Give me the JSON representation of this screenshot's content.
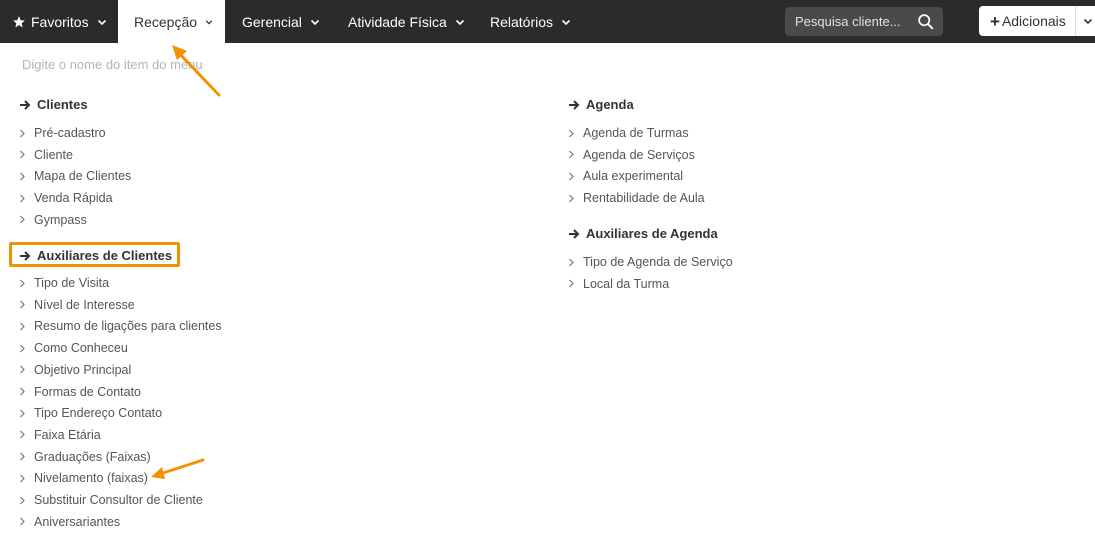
{
  "nav": {
    "favoritos": "Favoritos",
    "recepcao": "Recepção",
    "gerencial": "Gerencial",
    "atividade_fisica": "Atividade Física",
    "relatorios": "Relatórios",
    "search_placeholder": "Pesquisa cliente...",
    "adicionais": "Adicionais"
  },
  "menu_filter": {
    "placeholder": "Digite o nome do item do menu"
  },
  "clientes": {
    "title": "Clientes",
    "items": [
      "Pré-cadastro",
      "Cliente",
      "Mapa de Clientes",
      "Venda Rápida",
      "Gympass"
    ]
  },
  "auxiliares_clientes": {
    "title": "Auxiliares de Clientes",
    "items": [
      "Tipo de Visita",
      "Nível de Interesse",
      "Resumo de ligações para clientes",
      "Como Conheceu",
      "Objetivo Principal",
      "Formas de Contato",
      "Tipo Endereço Contato",
      "Faixa Etária",
      "Graduações (Faixas)",
      "Nivelamento (faixas)",
      "Substituir Consultor de Cliente",
      "Aniversariantes"
    ]
  },
  "agenda": {
    "title": "Agenda",
    "items": [
      "Agenda de Turmas",
      "Agenda de Serviços",
      "Aula experimental",
      "Rentabilidade de Aula"
    ]
  },
  "auxiliares_agenda": {
    "title": "Auxiliares de Agenda",
    "items": [
      "Tipo de Agenda de Serviço",
      "Local da Turma"
    ]
  },
  "colors": {
    "topbar": "#2b2b2b",
    "annotation": "#f39200",
    "text": "#555555",
    "heading": "#333333"
  }
}
